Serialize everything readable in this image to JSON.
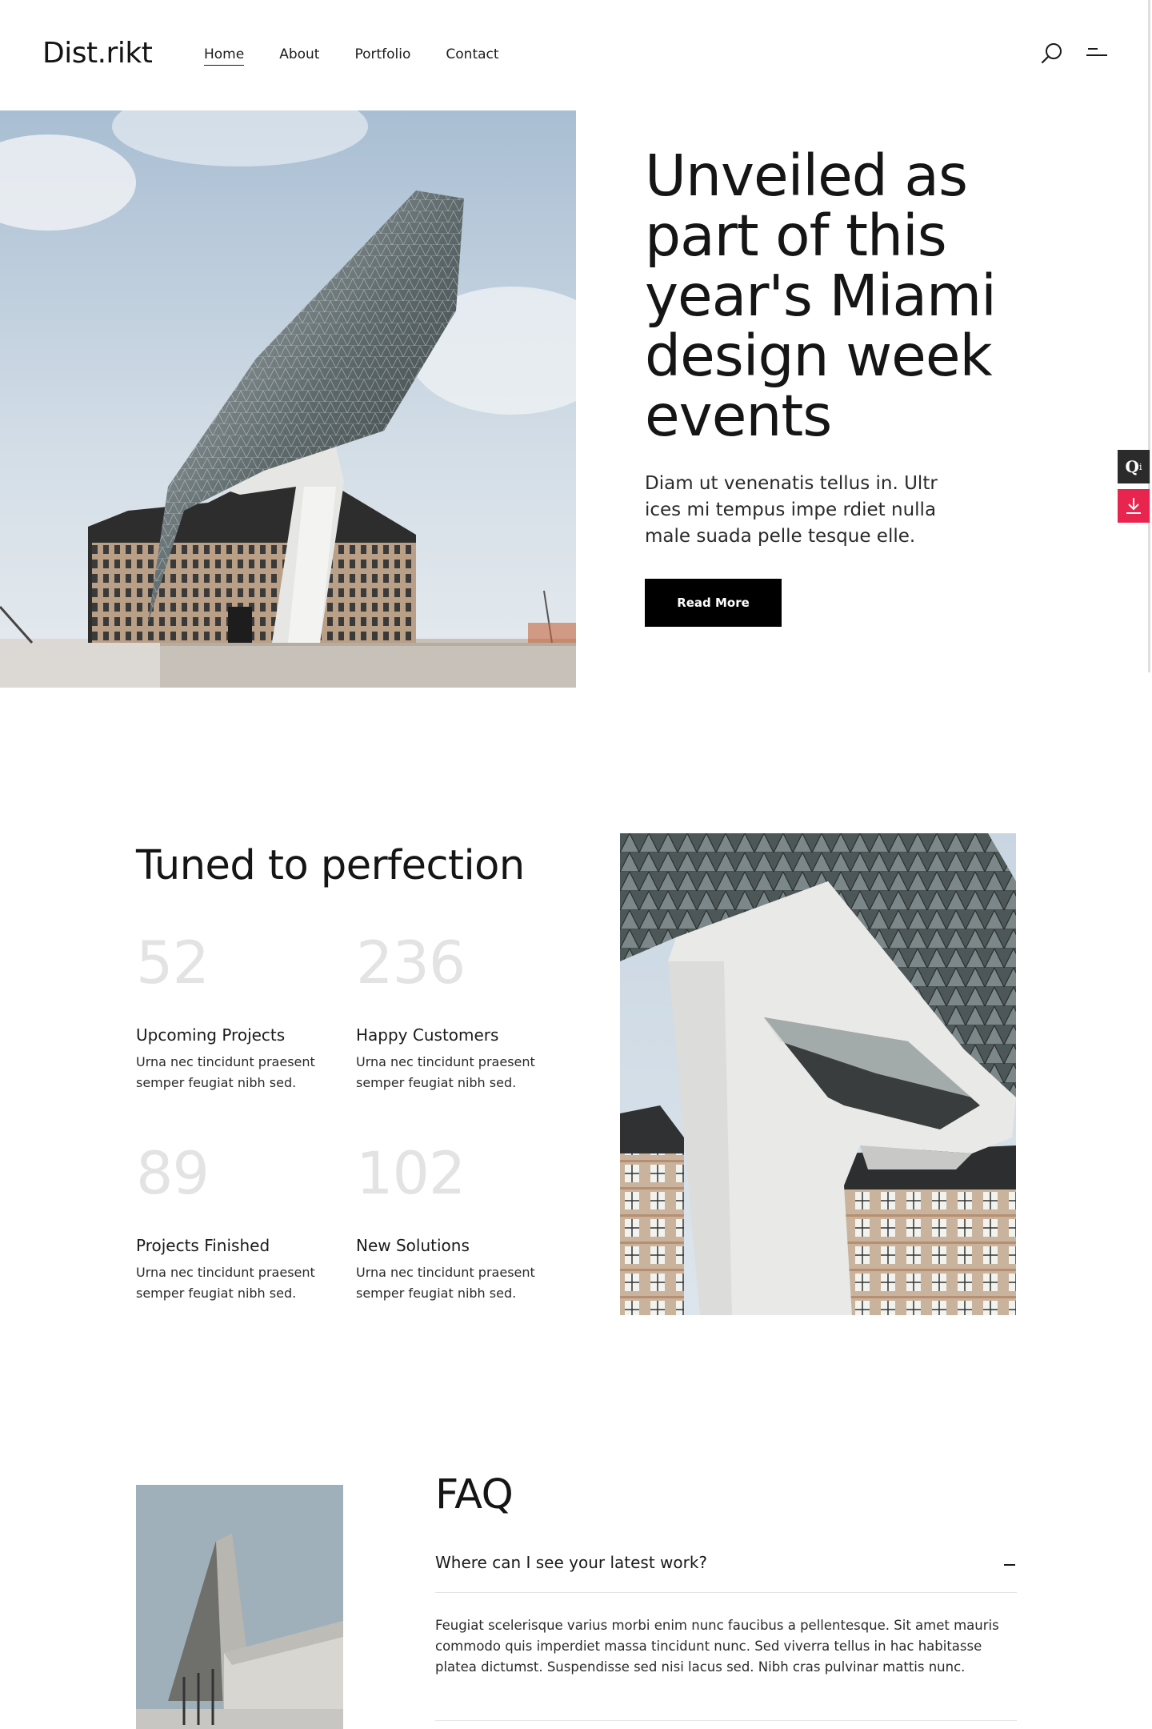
{
  "header": {
    "logo": "Dist.rikt",
    "nav": [
      {
        "label": "Home",
        "active": true
      },
      {
        "label": "About"
      },
      {
        "label": "Portfolio"
      },
      {
        "label": "Contact"
      }
    ],
    "icons": [
      "search-icon",
      "menu-icon"
    ]
  },
  "side_widgets": {
    "qi_label": "Q",
    "qi_sub": "i",
    "download_icon": "download-icon"
  },
  "hero": {
    "title": "Unveiled as part of this year's Miami design week events",
    "text": "Diam ut venenatis tellus in. Ultr ices mi tempus impe rdiet nulla male suada pelle tesque elle.",
    "button_label": "Read More"
  },
  "stats": {
    "title": "Tuned to perfection",
    "items": [
      {
        "number": "52",
        "label": "Upcoming Projects",
        "desc": "Urna nec tincidunt praesent semper feugiat nibh sed."
      },
      {
        "number": "236",
        "label": "Happy Customers",
        "desc": "Urna nec tincidunt praesent semper feugiat nibh sed."
      },
      {
        "number": "89",
        "label": "Projects Finished",
        "desc": "Urna nec tincidunt praesent semper feugiat nibh sed."
      },
      {
        "number": "102",
        "label": "New Solutions",
        "desc": "Urna nec tincidunt praesent semper feugiat nibh sed."
      }
    ]
  },
  "faq": {
    "title": "FAQ",
    "items": [
      {
        "question": "Where can I see your latest work?",
        "answer": "Feugiat scelerisque varius morbi enim nunc faucibus a pellentesque. Sit amet mauris commodo quis imperdiet massa tincidunt nunc. Sed viverra tellus in hac habitasse platea dictumst. Suspendisse sed nisi lacus sed. Nibh cras pulvinar mattis nunc.",
        "expanded": true
      }
    ]
  },
  "colors": {
    "accent_red": "#e8254f",
    "button_black": "#000000",
    "stat_number_gray": "#e3e3e3"
  }
}
